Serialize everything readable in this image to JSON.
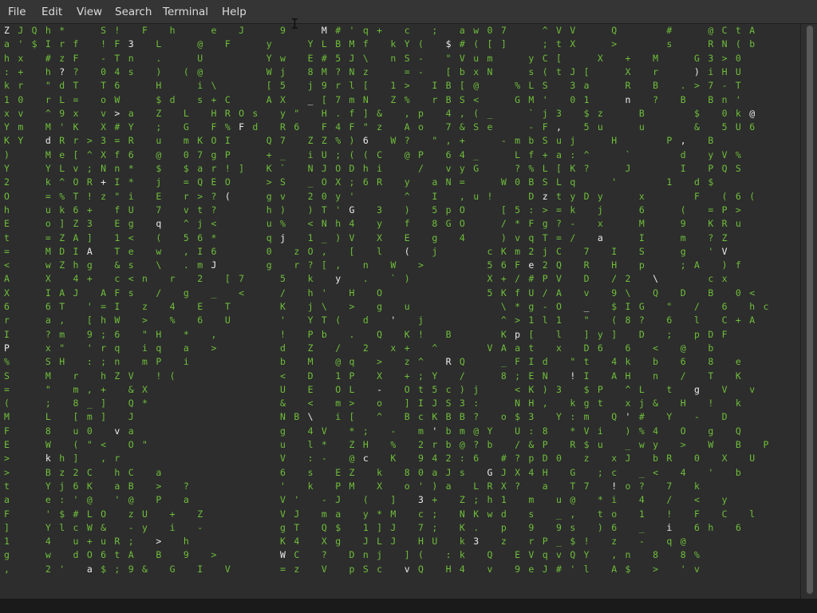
{
  "menubar": {
    "items": [
      "File",
      "Edit",
      "View",
      "Search",
      "Terminal",
      "Help"
    ]
  },
  "terminal": {
    "program": "cmatrix",
    "colors": {
      "glyph": "#6fbf3a",
      "highlight": "#ececec",
      "background": "#2d2d2d"
    },
    "rows": [
      "ZJQh*  S! F h  e J  9  M#'q+ c ; aw07  ^VV  Q   #  @CtA",
      "a'$Irf !F3 L  @ F  y  YLBMf kY( $#([]  ;tX  >   s  RN(b",
      "hx #zF -Tn .  U    Yw E#5J\\ nS- \"Vum  yC[  X + M  G3>0",
      ":+ h?? 04s ) (@    Wj 8M?Nz  =- [bxN  s(tJ[  X r  )iHU",
      "kr \"dT T6  H  i\\   [5 j9rl[ 1> IB[@  %LS 3a  R B .>7-T",
      "10 rL= oW  $d s+C  AX _[7mN Z% rBS<  GM' 01  n ? B Bn'",
      "xv ^9x v>a Z L HROs y\" H.f]& ,p 4,(_  `j3 $z  B   $ 0k@",
      "Ym M'K X#Y ; G F%Fd R6 F4F\"z Ao 7&Se  -F, 5u  u   & 5U6",
      "KY dRr>3=R u mKOI  Q7 ZZ%)6 W? \",+  -mbSuj  H   P, B",
      ")  Me[^Xf6 @ 07gP  +_ iU;((C @P 64_  Lf+a:^  `   d yV%",
      "Y  YLv;Nn* $ $ar!] K` NJODhi  / vyG  ?%L[K?  J   I PQS",
      "2  k^OR+I* j =QEO  >S _OX;6R y aN=  W0BSLq  '   1 d$",
      "O  =%T!z\"i E r>?(  gv 20y'   ^ I ,u!  DztyDy  x   F (6(",
      "h  uk6+ fU 7 vt?   h) )T'G 3 ) 5pO  [5:>=k j  6  ( =P>",
      "E  o]Z3 Eg q ^j<   u% <Nh4 y f 8GO  /*Fg?- x  M  9 KRu",
      "t  =ZA] 1< ( 56*   qj 1_)V X E g 4  )vqT=/ a  I  m ?Z",
      "=  MDIA Te w ,I6   0 zO, [ l ( j   cKm2jC 7 I S  g 'V",
      "<  wZhg &s \\ .mJ   g r?[, n W >    56Fe2Q R H p  ;A )f",
      "A  X 4+ c<n r 2 [7  5 k y . `)     X+/#PV D /2 \\   cx",
      "X  IAJ AFs / g _ <  / h' H O       5KfU/A v 9\\ Q D B 0<",
      "6  6T '=I z 4 E T   K j\\ > g u      \\*g-O _ $IG \" / 6 hc",
      "r  a, [hW > % 6 U   ' YT( d ' j     ^>1l1 \" (8? 6 l C+A",
      "I  ?m 9;6 \"H * ,    ! Pb . Q K! B   Kp[ l ]y] D ; pDF",
      "P  x\" 'rq iq a >    d Z / 2 x+ ^   VAat x D6 6 < @ b",
      "%  SH :;n mP i      b M @q > z^ RQ  _FId \"t 4k b 6 8 e",
      "S  M r hZV !(       < D 1P X +;Y /  8;EN !I AH n / T K",
      "=  \" m,+ &X         U E OL - Ot5c)j  <K)3 $P ^L t g V v",
      "(  ; 8_] Q*         & < m> o ]IJS3:  NH, kgt xj& H ! k",
      "M  L [m] J          NB\\ i[ ^ BcKBB? o$3 Y:m Q'# Y - D",
      "F  8 u0 va          g 4V *; - m'bm@Y U:8 *Vi )%4 O g Q",
      "E  W (\"< O\"         u l* ZH % 2rb@?b /&P R$u _wy > W B P",
      ">  kh] ,r           V :- @c K 942:6 #?pD0 z xJ bR 0 X U",
      ">  Bz2C hC a        6 s EZ k 80aJs GJX4H G ;c _< 4 ' b",
      "t  Yj6K aB > ?      ' k PM X o')a LRX? a T7 !o? 7 k",
      "a  e:'@ '@ P a      V' -J ( ] 3+ Z;h1 m u@ *i 4 / < y",
      "F  '$#LO zU + Z     VJ ma y*M c; NKwd s _, to 1 ! F C l",
      "]  YlcW& -y i -     gT Q$ 1]J 7; K. p 9 9s )6 _ i 6h 6",
      "1  4 u+uR; > h      K4 Xg JLJ HU k3 z rP_$! z - q@",
      "g  w dO6tA B 9 >    WC ? Dnj ]( :k Q EVqvQY ,n 8 8%",
      ",  2' a$;9& G I V   =z V pSc vQ H4 v 9eJ#'l A$ > 'v"
    ]
  }
}
